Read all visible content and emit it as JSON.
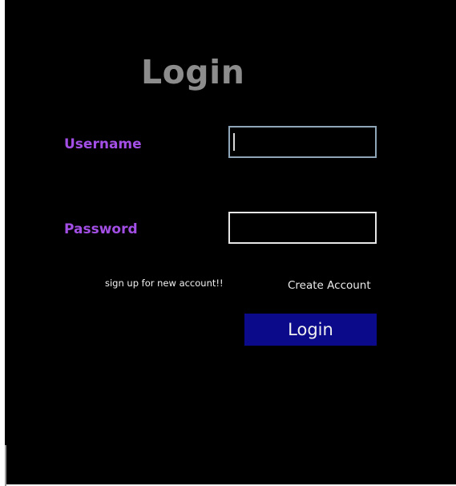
{
  "header": {
    "title": "Login"
  },
  "form": {
    "username_label": "Username",
    "username_value": "",
    "password_label": "Password",
    "password_value": "",
    "signup_prompt": "sign up for new account!!",
    "create_account_label": "Create Account",
    "login_button_label": "Login"
  },
  "colors": {
    "background": "#000000",
    "title": "#8c8c8c",
    "field_label": "#a34fe6",
    "login_button": "#0a0a8a",
    "text": "#f0f0f0"
  }
}
